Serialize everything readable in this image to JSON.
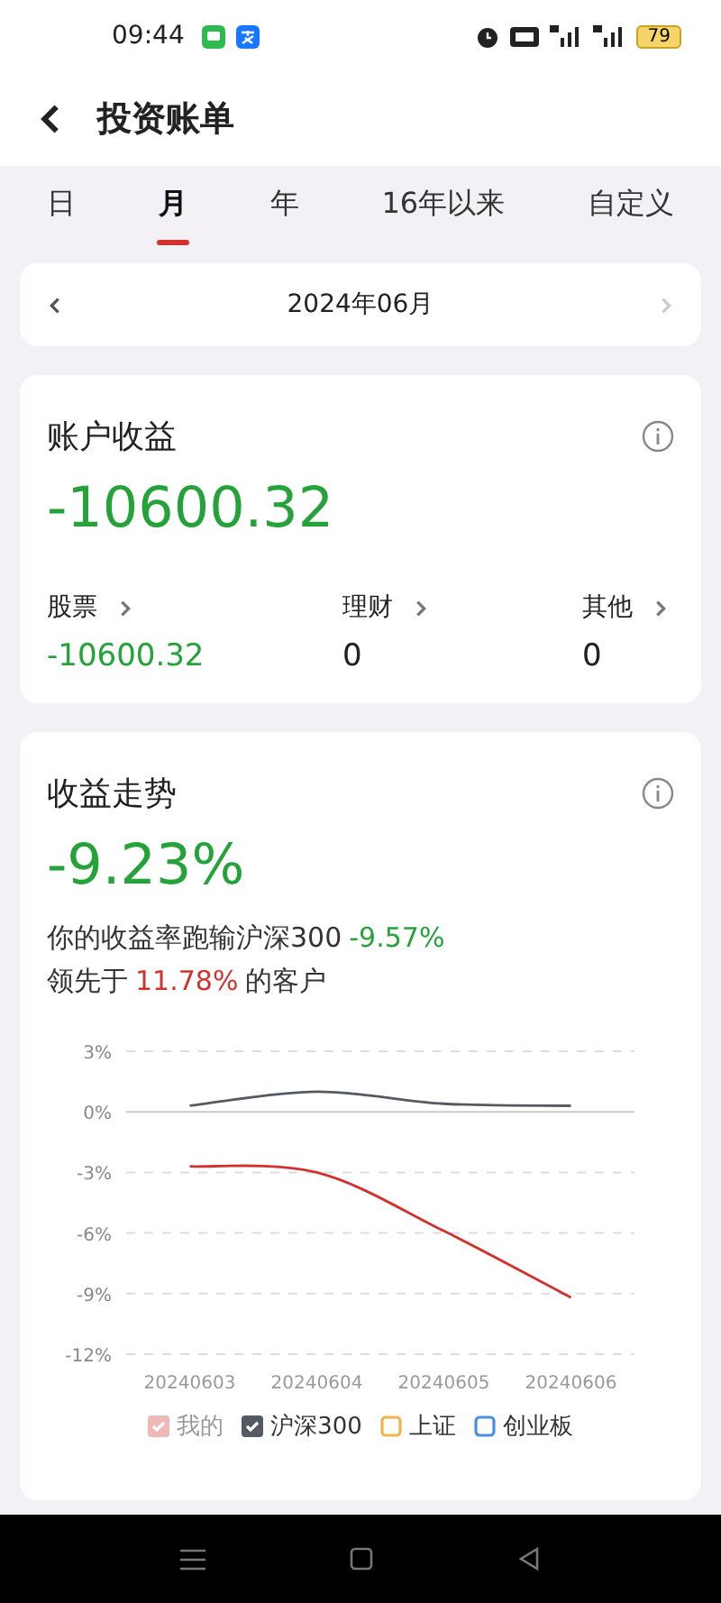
{
  "status_bar": {
    "time": "09:44",
    "battery": "79"
  },
  "header": {
    "title": "投资账单"
  },
  "tabs": [
    {
      "label": "日",
      "selected": false
    },
    {
      "label": "月",
      "selected": true
    },
    {
      "label": "年",
      "selected": false
    },
    {
      "label": "16年以来",
      "selected": false
    },
    {
      "label": "自定义",
      "selected": false
    }
  ],
  "period_picker": {
    "value": "2024年06月",
    "next_disabled": true
  },
  "account_card": {
    "title": "账户收益",
    "total": {
      "text": "-10600.32",
      "color": "#25a33a"
    },
    "categories": [
      {
        "label": "股票",
        "value": "-10600.32",
        "color": "#25a33a"
      },
      {
        "label": "理财",
        "value": "0",
        "color": "#222222"
      },
      {
        "label": "其他",
        "value": "0",
        "color": "#222222"
      }
    ]
  },
  "trend_card": {
    "title": "收益走势",
    "rate": {
      "text": "-9.23%",
      "color": "#25a33a"
    },
    "comparisons": [
      {
        "text": "你的收益率跑输沪深300",
        "value": "-9.57%",
        "color": "#25a33a"
      },
      {
        "text": "领先于",
        "value": "11.78%",
        "color": "#d2322d",
        "suffix": "的客户"
      }
    ],
    "chart_data": {
      "type": "line",
      "grid": true,
      "categories": [
        "20240603",
        "20240604",
        "20240605",
        "20240606"
      ],
      "series": [
        {
          "name": "我的",
          "color": "#d2322d",
          "values": [
            -2.7,
            -3.0,
            -5.9,
            -9.2
          ]
        },
        {
          "name": "沪深300",
          "color": "#555a60",
          "values": [
            0.3,
            1.0,
            0.4,
            0.3
          ]
        },
        {
          "name": "上证",
          "color": "#f0b54a",
          "values": [
            null,
            null,
            null,
            null
          ]
        },
        {
          "name": "创业板",
          "color": "#4a8fe0",
          "values": [
            null,
            null,
            null,
            null
          ]
        }
      ],
      "ylim": [
        -12,
        3
      ],
      "yticks": [
        {
          "value": 3,
          "label": "3%"
        },
        {
          "value": 0,
          "label": "0%"
        },
        {
          "value": -3,
          "label": "-3%"
        },
        {
          "value": -6,
          "label": "-6%"
        },
        {
          "value": -9,
          "label": "-9%"
        },
        {
          "value": -12,
          "label": "-12%"
        }
      ]
    },
    "legend": [
      {
        "checked": true,
        "disabled": true
      },
      {
        "checked": true,
        "disabled": false
      },
      {
        "checked": false,
        "disabled": false
      },
      {
        "checked": false,
        "disabled": false
      }
    ]
  }
}
